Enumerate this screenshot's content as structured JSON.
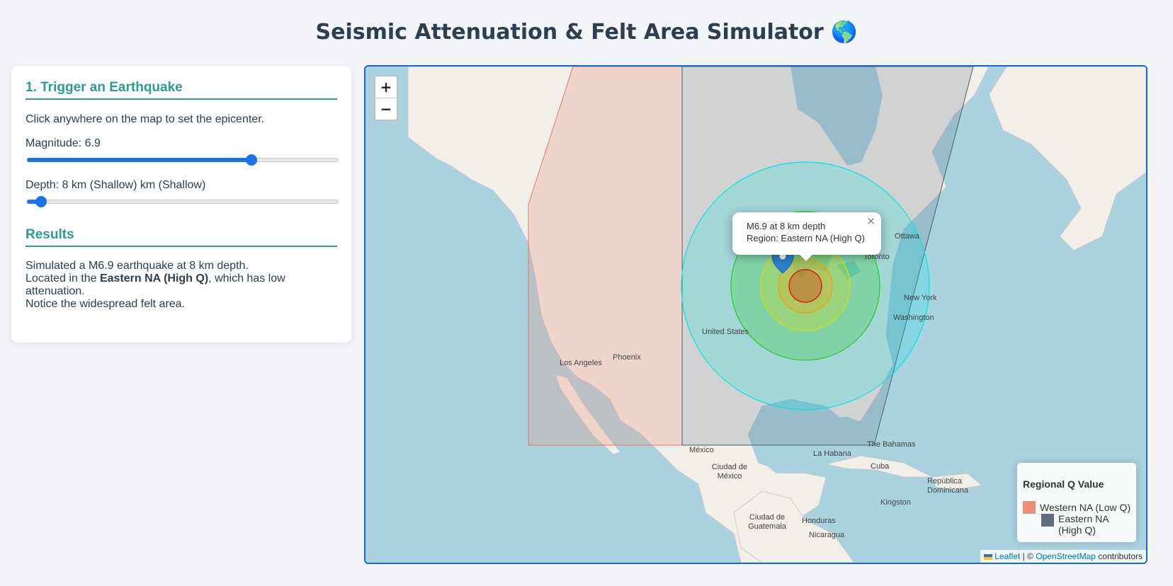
{
  "page": {
    "title": "Seismic Attenuation & Felt Area Simulator 🌎"
  },
  "controls": {
    "heading": "1. Trigger an Earthquake",
    "instruction": "Click anywhere on the map to set the epicenter.",
    "magnitude_label": "Magnitude: 6.9",
    "magnitude_level": 0.72,
    "depth_label": "Depth: 8 km (Shallow) km (Shallow)",
    "depth_level": 0.045
  },
  "results": {
    "heading": "Results",
    "line1": "Simulated a M6.9 earthquake at 8 km depth.",
    "line2_prefix": "Located in the ",
    "line2_bold": "Eastern NA (High Q)",
    "line2_suffix": ", which has low attenuation.",
    "line3": "Notice the widespread felt area."
  },
  "map": {
    "zoom_in": "+",
    "zoom_out": "−",
    "popup": {
      "line1": "M6.9 at 8 km depth",
      "line2": "Region: Eastern NA (High Q)",
      "close": "×"
    },
    "place_labels": [
      "Ottawa",
      "Toronto",
      "New York",
      "Washington",
      "United States",
      "Phoenix",
      "Los Angeles",
      "México",
      "Ciudad de México",
      "La Habana",
      "The Bahamas",
      "Cuba",
      "República Dominicana",
      "Kingston",
      "Ciudad de Guatemala",
      "Honduras",
      "Nicaragua"
    ],
    "legend": {
      "title": "Regional Q Value",
      "items": [
        "Western NA (Low Q)",
        "Eastern NA (High Q)"
      ],
      "colors": [
        "#e8917a",
        "#5d6d7e"
      ]
    },
    "attribution": {
      "leaflet": "Leaflet",
      "sep": " | © ",
      "osm": "OpenStreetMap",
      "suffix": " contributors",
      "flag_icon": "ukraine-flag-icon"
    },
    "felt_ring_colors": [
      "#00e5e5",
      "#22cc22",
      "#dddd00",
      "#ff9900",
      "#dd0000"
    ],
    "marker_icon": "map-pin-icon"
  }
}
